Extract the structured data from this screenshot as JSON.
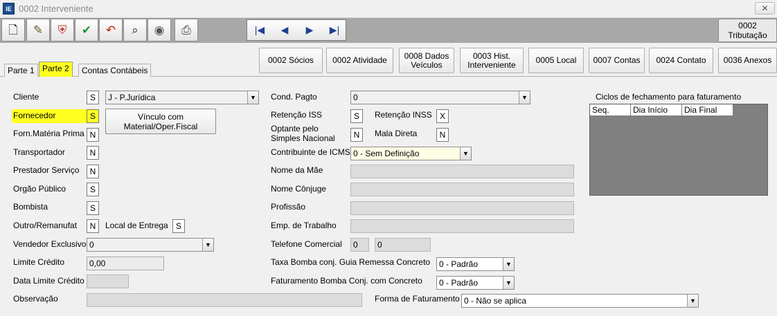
{
  "window": {
    "title": "0002 Interveniente",
    "close": "✕",
    "app_icon_text": "IE"
  },
  "toolbar": {
    "icons": [
      "new-document-icon",
      "edit-icon",
      "shield-icon",
      "check-icon",
      "undo-icon",
      "binoculars-icon",
      "disk-icon",
      "printer-icon"
    ],
    "glyphs": [
      "🗋",
      "✎",
      "⛨",
      "✔",
      "↶",
      "⌕",
      "◉",
      "⎙"
    ],
    "nav": [
      "|◀",
      "◀",
      "▶",
      "▶|"
    ],
    "tributacao": {
      "code": "0002",
      "label": "Tributação"
    }
  },
  "buttons": {
    "socios": "0002 Sócios",
    "atividade": "0002 Atividade",
    "dados_veiculos": [
      "0008 Dados",
      "Veículos"
    ],
    "hist": [
      "0003 Hist.",
      "Interveniente"
    ],
    "local": "0005 Local",
    "contas": "0007 Contas",
    "contato": "0024 Contato",
    "anexos": "0036 Anexos"
  },
  "tabs": [
    "Parte 1",
    "Parte 2",
    "Contas Contábeis"
  ],
  "left": {
    "cliente": {
      "label": "Cliente",
      "flag": "S",
      "tipo": "J - P.Jurídica"
    },
    "fornecedor": {
      "label": "Fornecedor",
      "flag": "S"
    },
    "vinculo_button": [
      "Vínculo com",
      "Material/Oper.Fiscal"
    ],
    "forn_materia": {
      "label": "Forn.Matéria Prima",
      "flag": "N"
    },
    "transportador": {
      "label": "Transportador",
      "flag": "N"
    },
    "prestador": {
      "label": "Prestador Serviço",
      "flag": "N"
    },
    "orgao": {
      "label": "Orgão Público",
      "flag": "S"
    },
    "bombista": {
      "label": "Bombista",
      "flag": "S"
    },
    "outro": {
      "label": "Outro/Remanufat",
      "flag": "N"
    },
    "local_entrega": {
      "label": "Local de Entrega",
      "flag": "S"
    },
    "vendedor": {
      "label": "Vendedor Exclusivo",
      "value": "0"
    },
    "limite": {
      "label": "Limite Crédito",
      "value": "0,00"
    },
    "data_limite": {
      "label": "Data Limite Crédito",
      "value": ""
    },
    "observacao": {
      "label": "Observação",
      "value": ""
    }
  },
  "middle": {
    "cond_pagto": {
      "label": "Cond. Pagto",
      "value": "0"
    },
    "retencao_iss": {
      "label": "Retenção ISS",
      "flag": "S"
    },
    "retencao_inss": {
      "label": "Retenção INSS",
      "flag": "X"
    },
    "optante": {
      "label": [
        "Optante pelo",
        "Simples Nacional"
      ],
      "flag": "N"
    },
    "mala_direta": {
      "label": "Mala Direta",
      "flag": "N"
    },
    "contribuinte": {
      "label": "Contribuinte de ICMS",
      "value": "0 - Sem Definição"
    },
    "nome_mae": {
      "label": "Nome da Mãe",
      "value": ""
    },
    "nome_conjuge": {
      "label": "Nome Cônjuge",
      "value": ""
    },
    "profissao": {
      "label": "Profissão",
      "value": ""
    },
    "emp_trabalho": {
      "label": "Emp. de Trabalho",
      "value": ""
    },
    "telefone": {
      "label": "Telefone Comercial",
      "ddd": "0",
      "numero": "0"
    },
    "taxa_bomba": {
      "label": "Taxa Bomba conj. Guia Remessa Concreto",
      "value": "0 - Padrão"
    },
    "fat_bomba": {
      "label": "Faturamento Bomba Conj. com Concreto",
      "value": "0 - Padrão"
    },
    "forma_fat": {
      "label": "Forma de Faturamento",
      "value": "0 - Não se aplica"
    }
  },
  "ciclos": {
    "title": "Ciclos de fechamento para faturamento",
    "columns": [
      "Seq.",
      "Dia Início",
      "Dia Final"
    ]
  }
}
